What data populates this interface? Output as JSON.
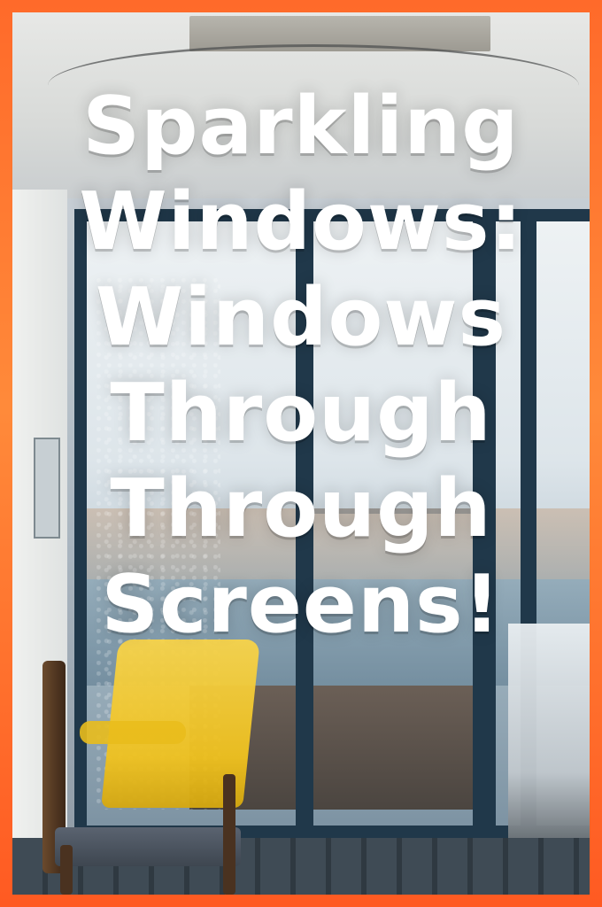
{
  "poster": {
    "title_lines": [
      "Sparkling",
      "Windows:",
      "Windows",
      "Through",
      "Through",
      "Screens!"
    ]
  },
  "colors": {
    "border_orange": "#ff6a2a",
    "title_text": "#ffffff",
    "window_frame": "#20384a",
    "chair_yellow": "#f0c21f"
  }
}
